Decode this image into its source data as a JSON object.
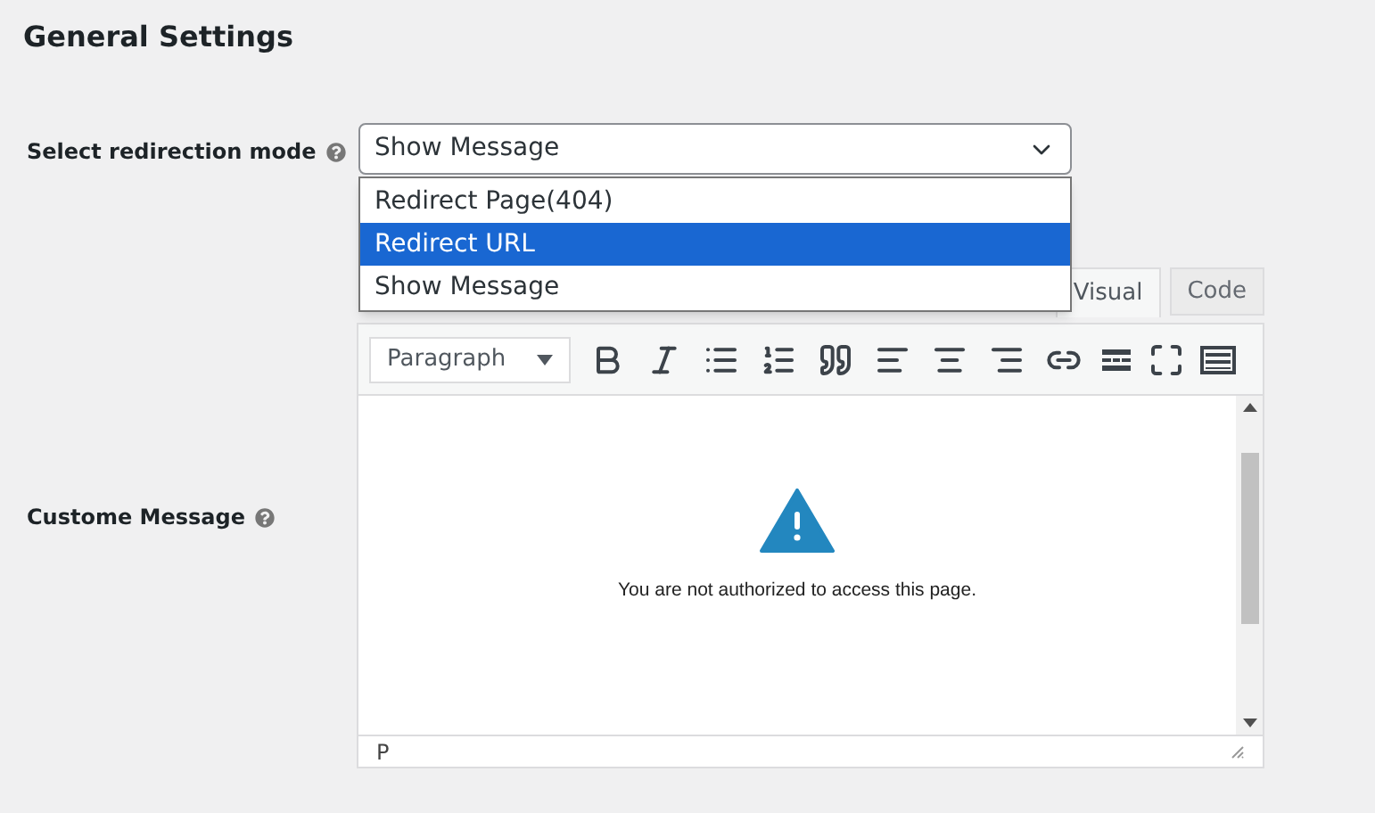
{
  "heading": "General Settings",
  "redirection": {
    "label": "Select redirection mode",
    "value": "Show Message",
    "expanded": true,
    "options": [
      {
        "label": "Redirect Page(404)",
        "highlighted": false
      },
      {
        "label": "Redirect URL",
        "highlighted": true
      },
      {
        "label": "Show Message",
        "highlighted": false
      }
    ]
  },
  "message": {
    "label": "Custome Message",
    "tabs": [
      {
        "label": "Visual",
        "selected": true
      },
      {
        "label": "Code",
        "selected": false
      }
    ],
    "format": "Paragraph",
    "content": "You are not authorized to access this page.",
    "path": "P"
  }
}
